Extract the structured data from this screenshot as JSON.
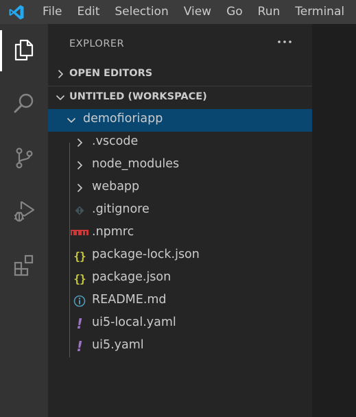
{
  "menubar": {
    "items": [
      "File",
      "Edit",
      "Selection",
      "View",
      "Go",
      "Run",
      "Terminal"
    ]
  },
  "activitybar": {
    "items": [
      {
        "icon": "explorer-icon",
        "active": true
      },
      {
        "icon": "search-icon"
      },
      {
        "icon": "source-control-icon"
      },
      {
        "icon": "run-debug-icon"
      },
      {
        "icon": "extensions-icon"
      }
    ]
  },
  "sidebar": {
    "title": "EXPLORER",
    "open_editors": "OPEN EDITORS",
    "workspace": "UNTITLED (WORKSPACE)",
    "tree": {
      "root": "demofioriapp",
      "folders": [
        ".vscode",
        "node_modules",
        "webapp"
      ],
      "files": [
        {
          "name": ".gitignore",
          "icon": "git-icon"
        },
        {
          "name": ".npmrc",
          "icon": "npm-icon"
        },
        {
          "name": "package-lock.json",
          "icon": "json-icon"
        },
        {
          "name": "package.json",
          "icon": "json-icon"
        },
        {
          "name": "README.md",
          "icon": "info-icon"
        },
        {
          "name": "ui5-local.yaml",
          "icon": "yaml-icon"
        },
        {
          "name": "ui5.yaml",
          "icon": "yaml-icon"
        }
      ]
    }
  },
  "colors": {
    "selection": "#094771",
    "json": "#cbcb41",
    "yaml": "#a074c4",
    "npm": "#cb3837",
    "info": "#519aba",
    "vscode_blue": "#23a9f2"
  }
}
